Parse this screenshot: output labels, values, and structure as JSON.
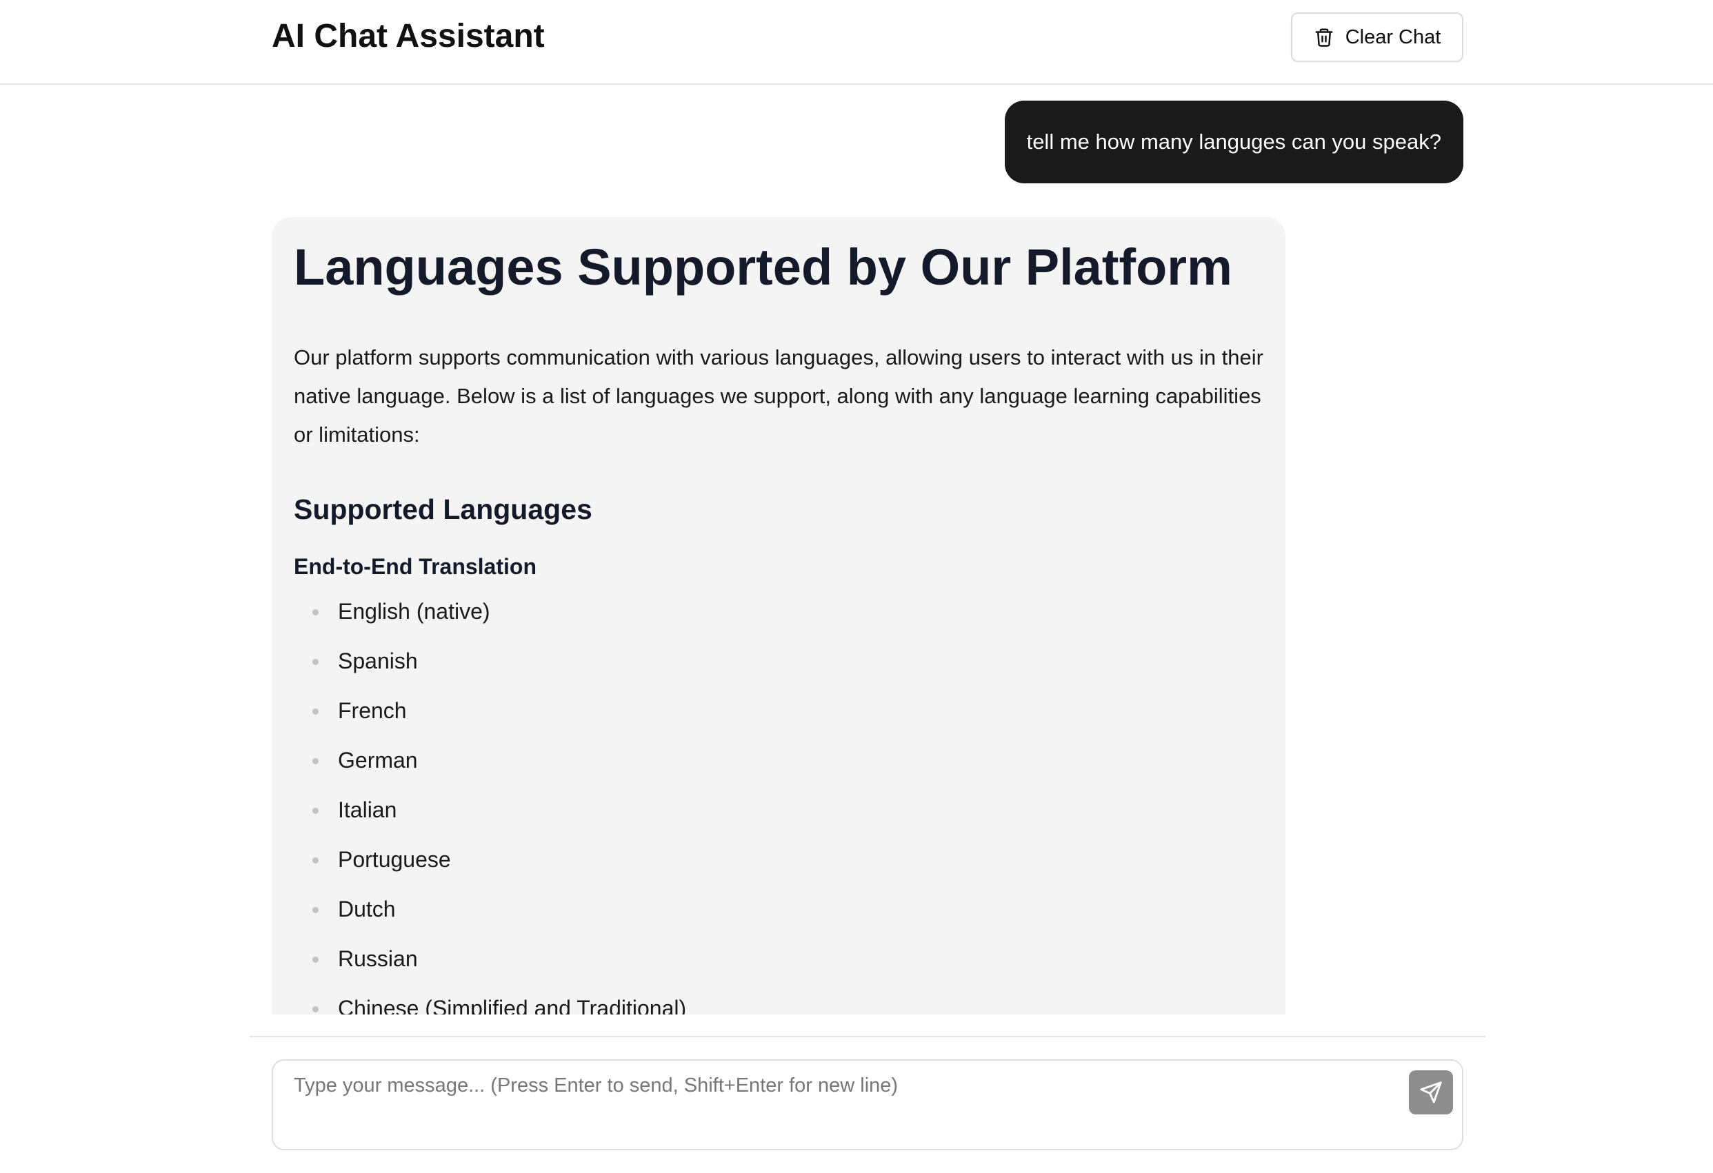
{
  "header": {
    "title": "AI Chat Assistant",
    "clear_button_label": "Clear Chat",
    "clear_button_icon": "trash-icon"
  },
  "conversation": {
    "user_message": "tell me how many languges can you speak?",
    "assistant_message": {
      "title": "Languages Supported by Our Platform",
      "intro": "Our platform supports communication with various languages, allowing users to interact with us in their native language. Below is a list of languages we support, along with any language learning capabilities or limitations:",
      "section_heading": "Supported Languages",
      "subsection_heading": "End-to-End Translation",
      "languages": [
        "English (native)",
        "Spanish",
        "French",
        "German",
        "Italian",
        "Portuguese",
        "Dutch",
        "Russian",
        "Chinese (Simplified and Traditional)"
      ]
    }
  },
  "composer": {
    "placeholder": "Type your message... (Press Enter to send, Shift+Enter for new line)",
    "value": "",
    "send_icon": "send-icon"
  },
  "colors": {
    "user_bubble_bg": "#1a1a1a",
    "assistant_bubble_bg": "#f4f4f4",
    "send_button_bg": "#8e8e8e",
    "heading_color": "#141a2a"
  }
}
